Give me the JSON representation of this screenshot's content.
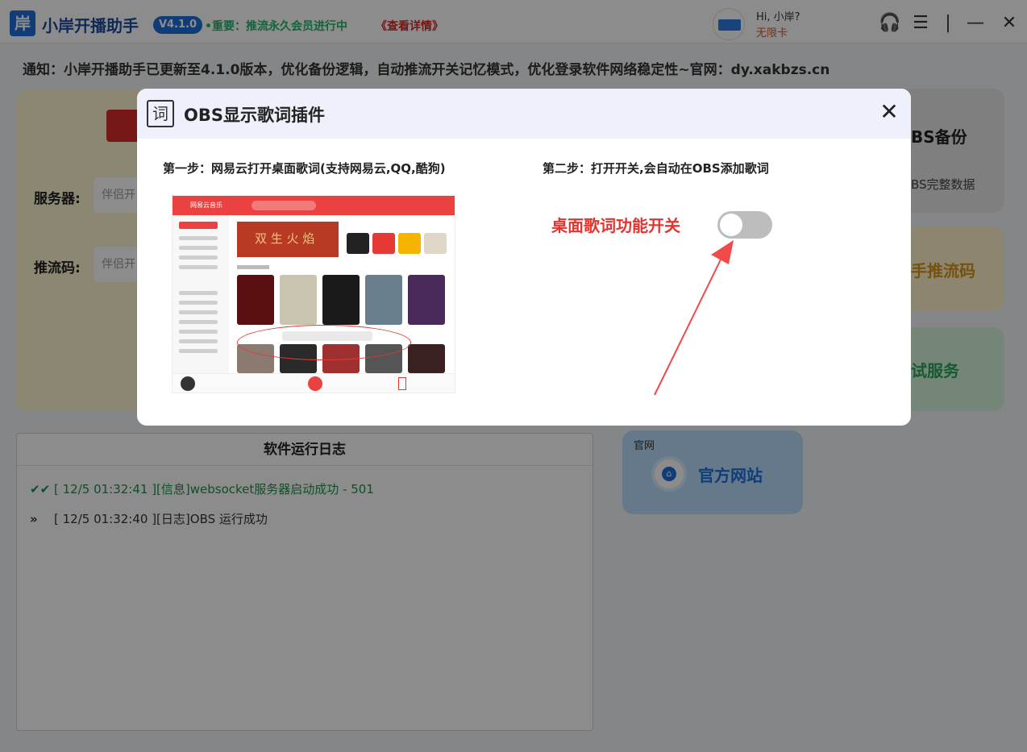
{
  "titlebar": {
    "logo_char": "岸",
    "app_name": "小岸开播助手",
    "version": "V4.1.0",
    "important_notice": "•重要：推流永久会员进行中",
    "details_link": "《查看详情》",
    "user_greeting": "Hi, 小岸?",
    "membership": "无限卡",
    "icons": [
      "headset-icon",
      "sliders-icon",
      "separator",
      "minimize-icon",
      "close-icon"
    ],
    "icon_glyphs": {
      "headset": "🎧",
      "sliders": "☰",
      "separator": "|",
      "minimize": "—",
      "close": "✕"
    }
  },
  "notice": "通知：小岸开播助手已更新至4.1.0版本，优化备份逻辑，自动推流开关记忆模式，优化登录软件网络稳定性~官网：dy.xakbzs.cn",
  "left_panel": {
    "server_label": "服务器:",
    "server_placeholder": "伴侣开",
    "stream_label": "推流码:",
    "stream_placeholder": "伴侣开"
  },
  "side_cards": {
    "backup_title": "BS备份",
    "backup_sub": "BS完整数据",
    "push_title": "手推流码",
    "test_title": "试服务"
  },
  "log": {
    "title": "软件运行日志",
    "lines": [
      {
        "mark": "✔✔",
        "text": "[ 12/5 01:32:41 ][信息]websocket服务器启动成功 - 501"
      },
      {
        "mark": "»",
        "text": "[ 12/5 01:32:40 ][日志]OBS 运行成功"
      }
    ]
  },
  "site_card": {
    "tag": "官网",
    "label": "官方网站"
  },
  "dialog": {
    "icon_char": "词",
    "title": "OBS显示歌词插件",
    "close_glyph": "✕",
    "step1": "第一步：网易云打开桌面歌词(支持网易云,QQ,酷狗)",
    "step2": "第二步：打开开关,会自动在OBS添加歌词",
    "toggle_label": "桌面歌词功能开关",
    "toggle_on": false,
    "screenshot": {
      "app_title": "网易云音乐",
      "banner_text": "双 生 火 焰"
    }
  },
  "colors": {
    "accent_blue": "#1e6fd9",
    "accent_red": "#e5342f",
    "netease_red": "#ec4141",
    "success_green": "#1e8f4a"
  }
}
